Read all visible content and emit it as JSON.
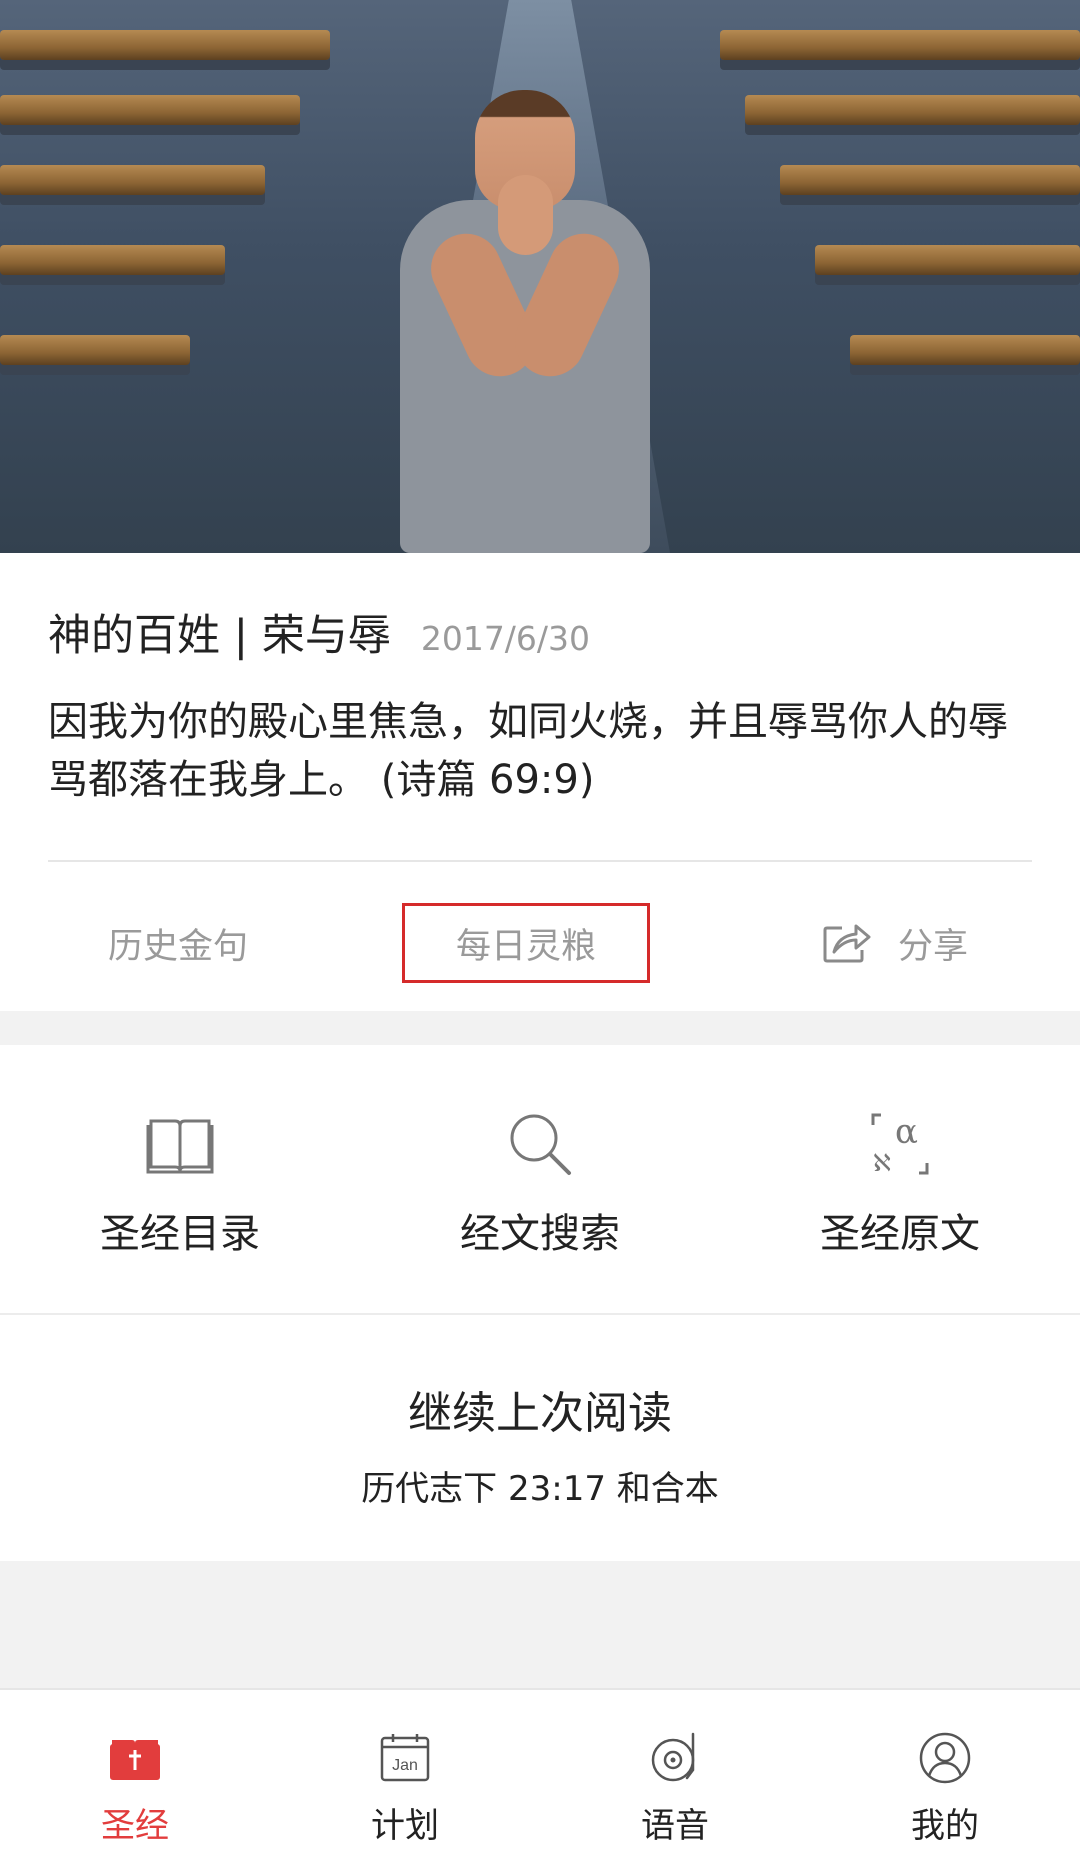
{
  "hero": {
    "image_description": ""
  },
  "card": {
    "title": "神的百姓 | 荣与辱",
    "date": "2017/6/30",
    "verse": "因我为你的殿心里焦急，如同火烧，并且辱骂你人的辱骂都落在我身上。 (诗篇 69:9)",
    "actions": {
      "history": "历史金句",
      "daily": "每日灵粮",
      "share": "分享"
    }
  },
  "features": [
    {
      "label": "圣经目录",
      "icon": "book-icon"
    },
    {
      "label": "经文搜索",
      "icon": "search-icon"
    },
    {
      "label": "圣经原文",
      "icon": "original-text-icon"
    }
  ],
  "continue_reading": {
    "title": "继续上次阅读",
    "location": "历代志下 23:17 和合本"
  },
  "bottom_nav": {
    "active_color": "#e23d3d",
    "items": [
      {
        "label": "圣经",
        "icon": "bible-icon",
        "active": true
      },
      {
        "label": "计划",
        "icon": "calendar-icon",
        "calendar_text": "Jan",
        "active": false
      },
      {
        "label": "语音",
        "icon": "audio-icon",
        "active": false
      },
      {
        "label": "我的",
        "icon": "profile-icon",
        "active": false
      }
    ]
  }
}
